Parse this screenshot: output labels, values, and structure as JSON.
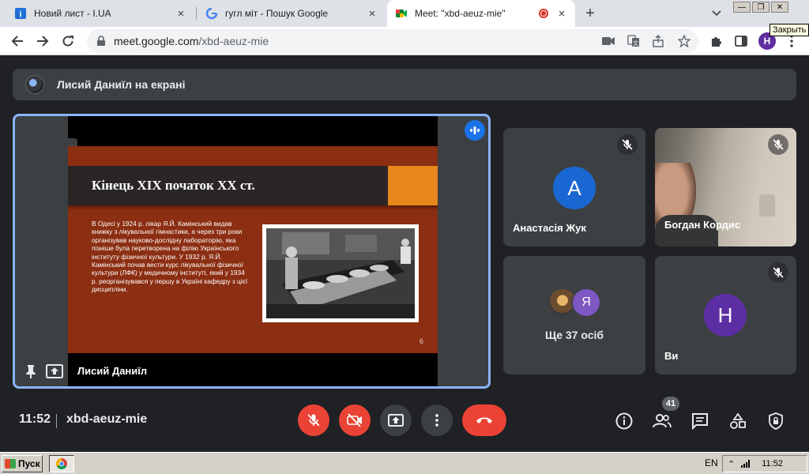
{
  "browser": {
    "tabs": [
      {
        "title": "Новий лист - I.UA",
        "favicon": "i-ua-icon"
      },
      {
        "title": "гугл міт - Пошук Google",
        "favicon": "google-icon"
      },
      {
        "title": "Meet: \"xbd-aeuz-mie\"",
        "favicon": "meet-icon",
        "recording": true
      }
    ],
    "tooltip": "Закрыть",
    "url": {
      "host": "meet.google.com",
      "path": "/xbd-aeuz-mie"
    },
    "profile_initial": "H"
  },
  "meet": {
    "presenting_banner": "Лисий Даниїл на екрані",
    "slide": {
      "title": "Кінець XIX початок XX ст.",
      "body": "В Одесі у 1924 р. лікар Я.Й. Камінський видав книжку з лікувальної гімнастики, а через три роки організував науково-дослідну лабораторію, яка пізніше була перетворена на філію Українського інституту фізичної культури. У 1932 р. Я.Й. Камінський почав вести курс лікувальної фізичної культури (ЛФК) у медичному інституті, який у 1934 р. реорганізувався у першу в Україні кафедру з цієї дисципліни.",
      "number": "6"
    },
    "presenter_name": "Лисий Даниїл",
    "participants": [
      {
        "name": "Анастасія Жук",
        "initial": "А",
        "color": "#1967d2"
      },
      {
        "name": "Богдан Кордис"
      },
      {
        "label": "Ще 37 осіб",
        "second_initial": "Я",
        "second_color": "#7e57c2"
      },
      {
        "name": "Ви",
        "initial": "H",
        "color": "#5b2fa3"
      }
    ],
    "controls": {
      "time": "11:52",
      "meeting_code": "xbd-aeuz-mie",
      "participant_count": "41"
    },
    "accent_color": "#8ab4f8",
    "danger_color": "#ea4335"
  },
  "taskbar": {
    "start_label": "Пуск",
    "language": "EN",
    "time": "11:52"
  }
}
